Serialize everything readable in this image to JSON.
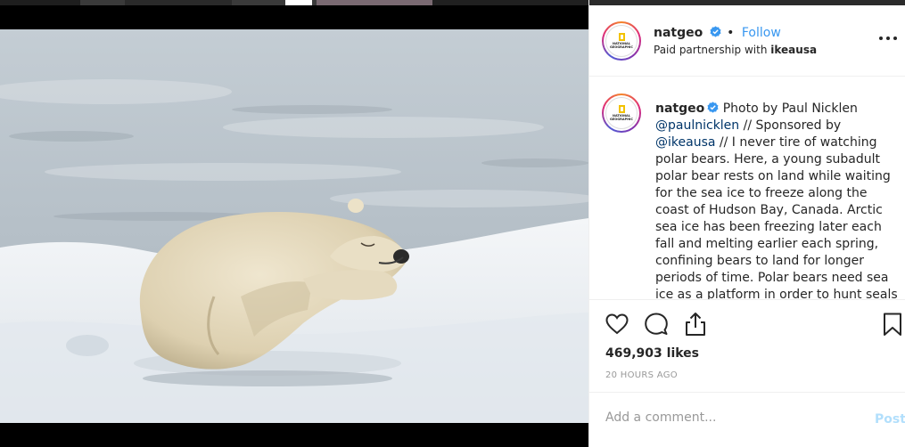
{
  "header": {
    "username": "natgeo",
    "dot": "•",
    "follow_label": "Follow",
    "partnership_prefix": "Paid partnership with",
    "partner": "ikeausa"
  },
  "avatar": {
    "logo_text": "NATIONAL GEOGRAPHIC",
    "frame_color": "#f2c200"
  },
  "caption": {
    "username": "natgeo",
    "part1": "Photo by Paul Nicklen",
    "mention1": "@paulnicklen",
    "part2": "// Sponsored by",
    "mention2": "@ikeausa",
    "part3": "// I never tire of watching polar bears. Here, a young subadult polar bear rests on land while waiting for the sea ice to freeze along the coast of Hudson Bay, Canada. Arctic sea ice has been freezing later each fall and melting earlier each spring, confining bears to land for longer periods of time. Polar bears need sea ice as a platform in order to hunt seals"
  },
  "actions": {
    "like_icon": "heart-icon",
    "comment_icon": "speech-bubble-icon",
    "share_icon": "share-icon",
    "save_icon": "bookmark-icon"
  },
  "likes": "469,903 likes",
  "timestamp": "20 HOURS AGO",
  "comment": {
    "placeholder": "Add a comment...",
    "post_label": "Post"
  },
  "colors": {
    "link": "#3897f0",
    "mention": "#003569",
    "verified": "#3897f0",
    "post_disabled": "#b2dffc"
  }
}
